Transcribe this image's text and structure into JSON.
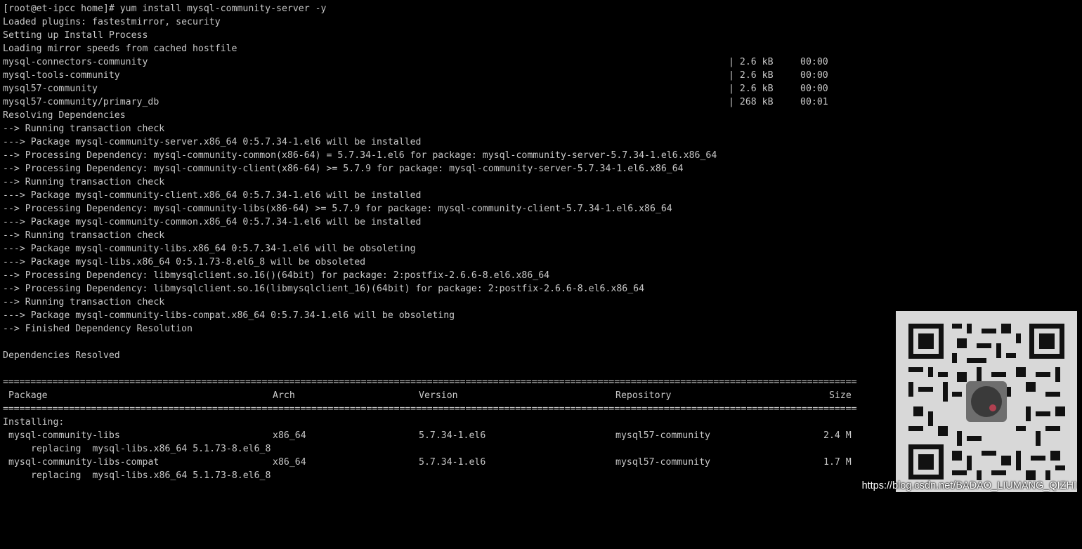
{
  "terminal": {
    "prompt_line": "[root@et-ipcc home]# yum install mysql-community-server -y",
    "lines": [
      "Loaded plugins: fastestmirror, security",
      "Setting up Install Process",
      "Loading mirror speeds from cached hostfile"
    ],
    "repos": [
      {
        "name": "mysql-connectors-community",
        "size": "| 2.6 kB",
        "time": "00:00"
      },
      {
        "name": "mysql-tools-community",
        "size": "| 2.6 kB",
        "time": "00:00"
      },
      {
        "name": "mysql57-community",
        "size": "| 2.6 kB",
        "time": "00:00"
      },
      {
        "name": "mysql57-community/primary_db",
        "size": "| 268 kB",
        "time": "00:01"
      }
    ],
    "dep_lines": [
      "Resolving Dependencies",
      "--> Running transaction check",
      "---> Package mysql-community-server.x86_64 0:5.7.34-1.el6 will be installed",
      "--> Processing Dependency: mysql-community-common(x86-64) = 5.7.34-1.el6 for package: mysql-community-server-5.7.34-1.el6.x86_64",
      "--> Processing Dependency: mysql-community-client(x86-64) >= 5.7.9 for package: mysql-community-server-5.7.34-1.el6.x86_64",
      "--> Running transaction check",
      "---> Package mysql-community-client.x86_64 0:5.7.34-1.el6 will be installed",
      "--> Processing Dependency: mysql-community-libs(x86-64) >= 5.7.9 for package: mysql-community-client-5.7.34-1.el6.x86_64",
      "---> Package mysql-community-common.x86_64 0:5.7.34-1.el6 will be installed",
      "--> Running transaction check",
      "---> Package mysql-community-libs.x86_64 0:5.7.34-1.el6 will be obsoleting",
      "---> Package mysql-libs.x86_64 0:5.1.73-8.el6_8 will be obsoleted",
      "--> Processing Dependency: libmysqlclient.so.16()(64bit) for package: 2:postfix-2.6.6-8.el6.x86_64",
      "--> Processing Dependency: libmysqlclient.so.16(libmysqlclient_16)(64bit) for package: 2:postfix-2.6.6-8.el6.x86_64",
      "--> Running transaction check",
      "---> Package mysql-community-libs-compat.x86_64 0:5.7.34-1.el6 will be obsoleting",
      "--> Finished Dependency Resolution"
    ],
    "resolved": "Dependencies Resolved",
    "separator": "================================================================================================================================================================",
    "table": {
      "headers": {
        "package": "Package",
        "arch": "Arch",
        "version": "Version",
        "repository": "Repository",
        "size": "Size"
      },
      "installing_label": "Installing:",
      "rows": [
        {
          "package": "mysql-community-libs",
          "arch": "x86_64",
          "version": "5.7.34-1.el6",
          "repository": "mysql57-community",
          "size": "2.4 M",
          "replacing": "replacing  mysql-libs.x86_64 5.1.73-8.el6_8"
        },
        {
          "package": "mysql-community-libs-compat",
          "arch": "x86_64",
          "version": "5.7.34-1.el6",
          "repository": "mysql57-community",
          "size": "1.7 M",
          "replacing": "replacing  mysql-libs.x86_64 5.1.73-8.el6_8"
        }
      ]
    }
  },
  "watermark": {
    "text": "https://blog.csdn.net/BADAO_LIUMANG_QIZHI"
  },
  "colors": {
    "background": "#000000",
    "text": "#c8c8c8"
  }
}
